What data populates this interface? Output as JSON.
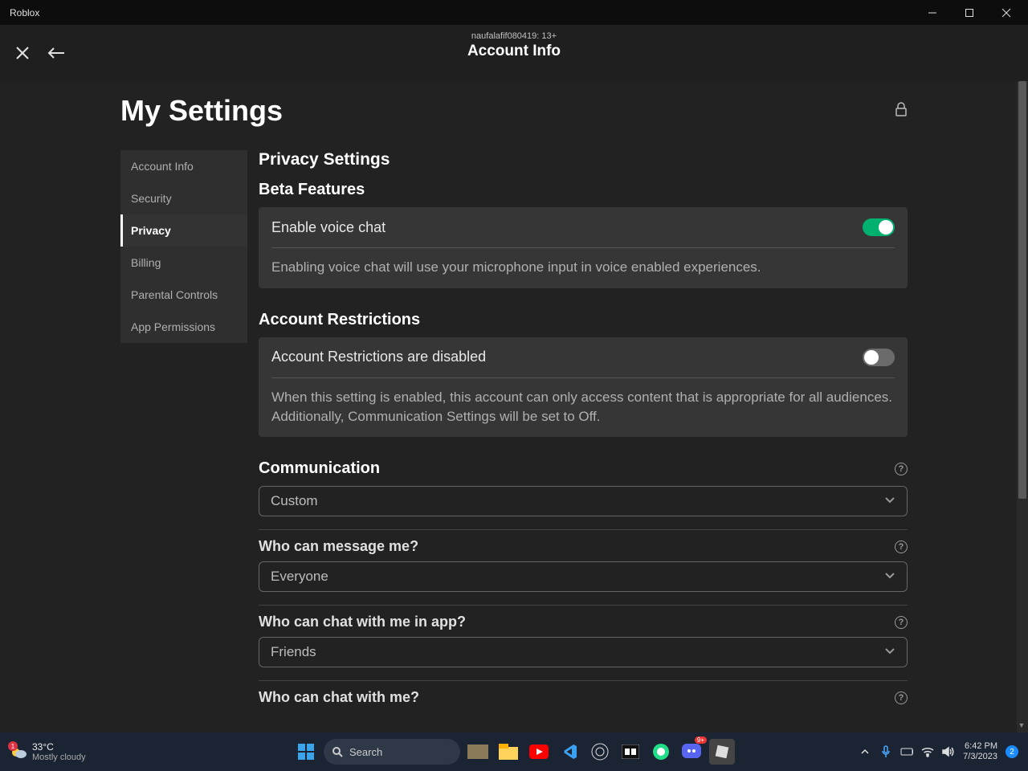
{
  "window": {
    "title": "Roblox"
  },
  "header": {
    "subtitle": "naufalafif080419: 13+",
    "title": "Account Info"
  },
  "page": {
    "title": "My Settings"
  },
  "sidebar": {
    "items": [
      "Account Info",
      "Security",
      "Privacy",
      "Billing",
      "Parental Controls",
      "App Permissions"
    ],
    "active": 2
  },
  "privacy": {
    "title": "Privacy Settings",
    "beta": {
      "title": "Beta Features",
      "voice": {
        "label": "Enable voice chat",
        "on": true,
        "desc": "Enabling voice chat will use your microphone input in voice enabled experiences."
      }
    },
    "restrictions": {
      "title": "Account Restrictions",
      "label": "Account Restrictions are disabled",
      "on": false,
      "desc": "When this setting is enabled, this account can only access content that is appropriate for all audiences. Additionally, Communication Settings will be set to Off."
    },
    "communication": {
      "title": "Communication",
      "mode": "Custom",
      "fields": [
        {
          "label": "Who can message me?",
          "value": "Everyone"
        },
        {
          "label": "Who can chat with me in app?",
          "value": "Friends"
        },
        {
          "label": "Who can chat with me?",
          "value": ""
        }
      ]
    }
  },
  "taskbar": {
    "weather": {
      "temp": "33°C",
      "cond": "Mostly cloudy",
      "badge": "1"
    },
    "search": "Search",
    "time": "6:42 PM",
    "date": "7/3/2023",
    "notif": "2",
    "discord_badge": "9+"
  }
}
